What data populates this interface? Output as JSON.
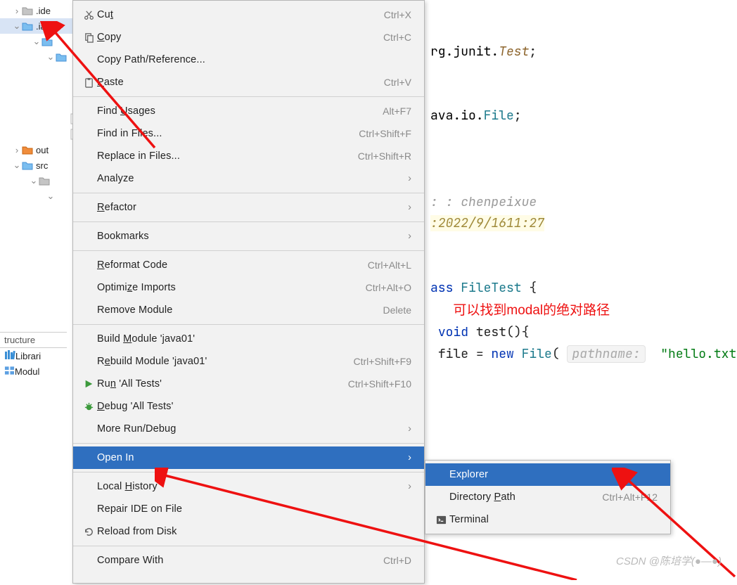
{
  "tree": {
    "items": [
      {
        "label": ".ide",
        "indent": 18,
        "arrow": "›",
        "iconType": "folder-gray"
      },
      {
        "label": ".iav",
        "indent": 18,
        "arrow": "⌄",
        "selected": true,
        "iconType": "folder-blue"
      },
      {
        "label": "",
        "indent": 46,
        "arrow": "⌄",
        "iconType": "folder-blue"
      },
      {
        "label": "",
        "indent": 66,
        "arrow": "⌄",
        "iconType": "folder-blue"
      },
      {
        "label": "",
        "indent": 86,
        "arrow": "",
        "iconType": ""
      },
      {
        "label": "",
        "indent": 86,
        "arrow": "",
        "iconType": ""
      },
      {
        "label": "",
        "indent": 86,
        "arrow": "",
        "iconType": ""
      },
      {
        "label": "",
        "indent": 86,
        "arrow": "",
        "iconType": "java-file"
      },
      {
        "label": "",
        "indent": 86,
        "arrow": "",
        "iconType": "java-file"
      },
      {
        "label": "out",
        "indent": 18,
        "arrow": "›",
        "iconType": "folder-orange"
      },
      {
        "label": "src",
        "indent": 18,
        "arrow": "⌄",
        "iconType": "folder-blue"
      },
      {
        "label": "",
        "indent": 42,
        "arrow": "⌄",
        "iconType": "folder-gray"
      },
      {
        "label": "",
        "indent": 66,
        "arrow": "⌄",
        "iconType": ""
      }
    ]
  },
  "structure": {
    "header": "tructure",
    "rows": [
      {
        "icon": "libraries",
        "label": "Librari"
      },
      {
        "icon": "modules",
        "label": "Modul"
      }
    ]
  },
  "menu_main": [
    {
      "type": "item",
      "icon": "cut",
      "label": "Cu<u>t</u>",
      "hint": "Ctrl+X"
    },
    {
      "type": "item",
      "icon": "copy",
      "label": "<u>C</u>opy",
      "hint": "Ctrl+C"
    },
    {
      "type": "item",
      "label": "Copy Path/Reference..."
    },
    {
      "type": "item",
      "icon": "paste",
      "label": "<u>P</u>aste",
      "hint": "Ctrl+V"
    },
    {
      "type": "sep"
    },
    {
      "type": "item",
      "label": "Find <u>U</u>sages",
      "hint": "Alt+F7"
    },
    {
      "type": "item",
      "label": "Find in Files...",
      "hint": "Ctrl+Shift+F"
    },
    {
      "type": "item",
      "label": "Replace in Files...",
      "hint": "Ctrl+Shift+R"
    },
    {
      "type": "item",
      "label": "Analyze",
      "sub": true
    },
    {
      "type": "sep"
    },
    {
      "type": "item",
      "label": "<u>R</u>efactor",
      "sub": true
    },
    {
      "type": "sep"
    },
    {
      "type": "item",
      "label": "Bookmarks",
      "sub": true
    },
    {
      "type": "sep"
    },
    {
      "type": "item",
      "label": "<u>R</u>eformat Code",
      "hint": "Ctrl+Alt+L"
    },
    {
      "type": "item",
      "label": "Optimi<u>z</u>e Imports",
      "hint": "Ctrl+Alt+O"
    },
    {
      "type": "item",
      "label": "Remove Module",
      "hint": "Delete"
    },
    {
      "type": "sep"
    },
    {
      "type": "item",
      "label": "Build <u>M</u>odule 'java01'"
    },
    {
      "type": "item",
      "label": "R<u>e</u>build Module 'java01'",
      "hint": "Ctrl+Shift+F9"
    },
    {
      "type": "item",
      "icon": "run",
      "label": "Ru<u>n</u> 'All Tests'",
      "hint": "Ctrl+Shift+F10"
    },
    {
      "type": "item",
      "icon": "debug",
      "label": "<u>D</u>ebug 'All Tests'"
    },
    {
      "type": "item",
      "label": "More Run/Debug",
      "sub": true
    },
    {
      "type": "sep"
    },
    {
      "type": "item",
      "label": "Open In",
      "sub": true,
      "hl": true
    },
    {
      "type": "sep"
    },
    {
      "type": "item",
      "label": "Local <u>H</u>istory",
      "sub": true
    },
    {
      "type": "item",
      "label": "Repair IDE on File"
    },
    {
      "type": "item",
      "icon": "reload",
      "label": "Reload from Disk"
    },
    {
      "type": "sep"
    },
    {
      "type": "item",
      "label": "Compare With",
      "hint": "Ctrl+D"
    }
  ],
  "menu_sub": [
    {
      "type": "item",
      "label": "Explorer",
      "hl": true
    },
    {
      "type": "item",
      "label": "Directory <u>P</u>ath",
      "hint": "Ctrl+Alt+F12"
    },
    {
      "type": "item",
      "icon": "terminal",
      "label": "Terminal"
    }
  ],
  "code": {
    "line1_prefix": "rg.junit.",
    "line1_class": "Test",
    "line1_end": ";",
    "line2_prefix": "ava.io.",
    "line2_class": "File",
    "line2_end": ";",
    "cmt_author_lbl": ": :",
    "cmt_author": "chenpeixue",
    "cmt_date_lbl": ":",
    "cmt_date": "2022/9/1611:27",
    "class_kw": "ass ",
    "class_name": "FileTest",
    "class_open": " {",
    "anno": "可以找到modal的绝对路径",
    "method_kw": "void ",
    "method_name": "test",
    "method_sig": "(){",
    "var": "file",
    "eq": " = ",
    "new_kw": "new ",
    "ctor": "File",
    "paren": "( ",
    "hint": "pathname:",
    "sp": "  ",
    "str": "\"hello.txt\"",
    "end": ");"
  },
  "watermark": "CSDN @陈培学(●—●)"
}
